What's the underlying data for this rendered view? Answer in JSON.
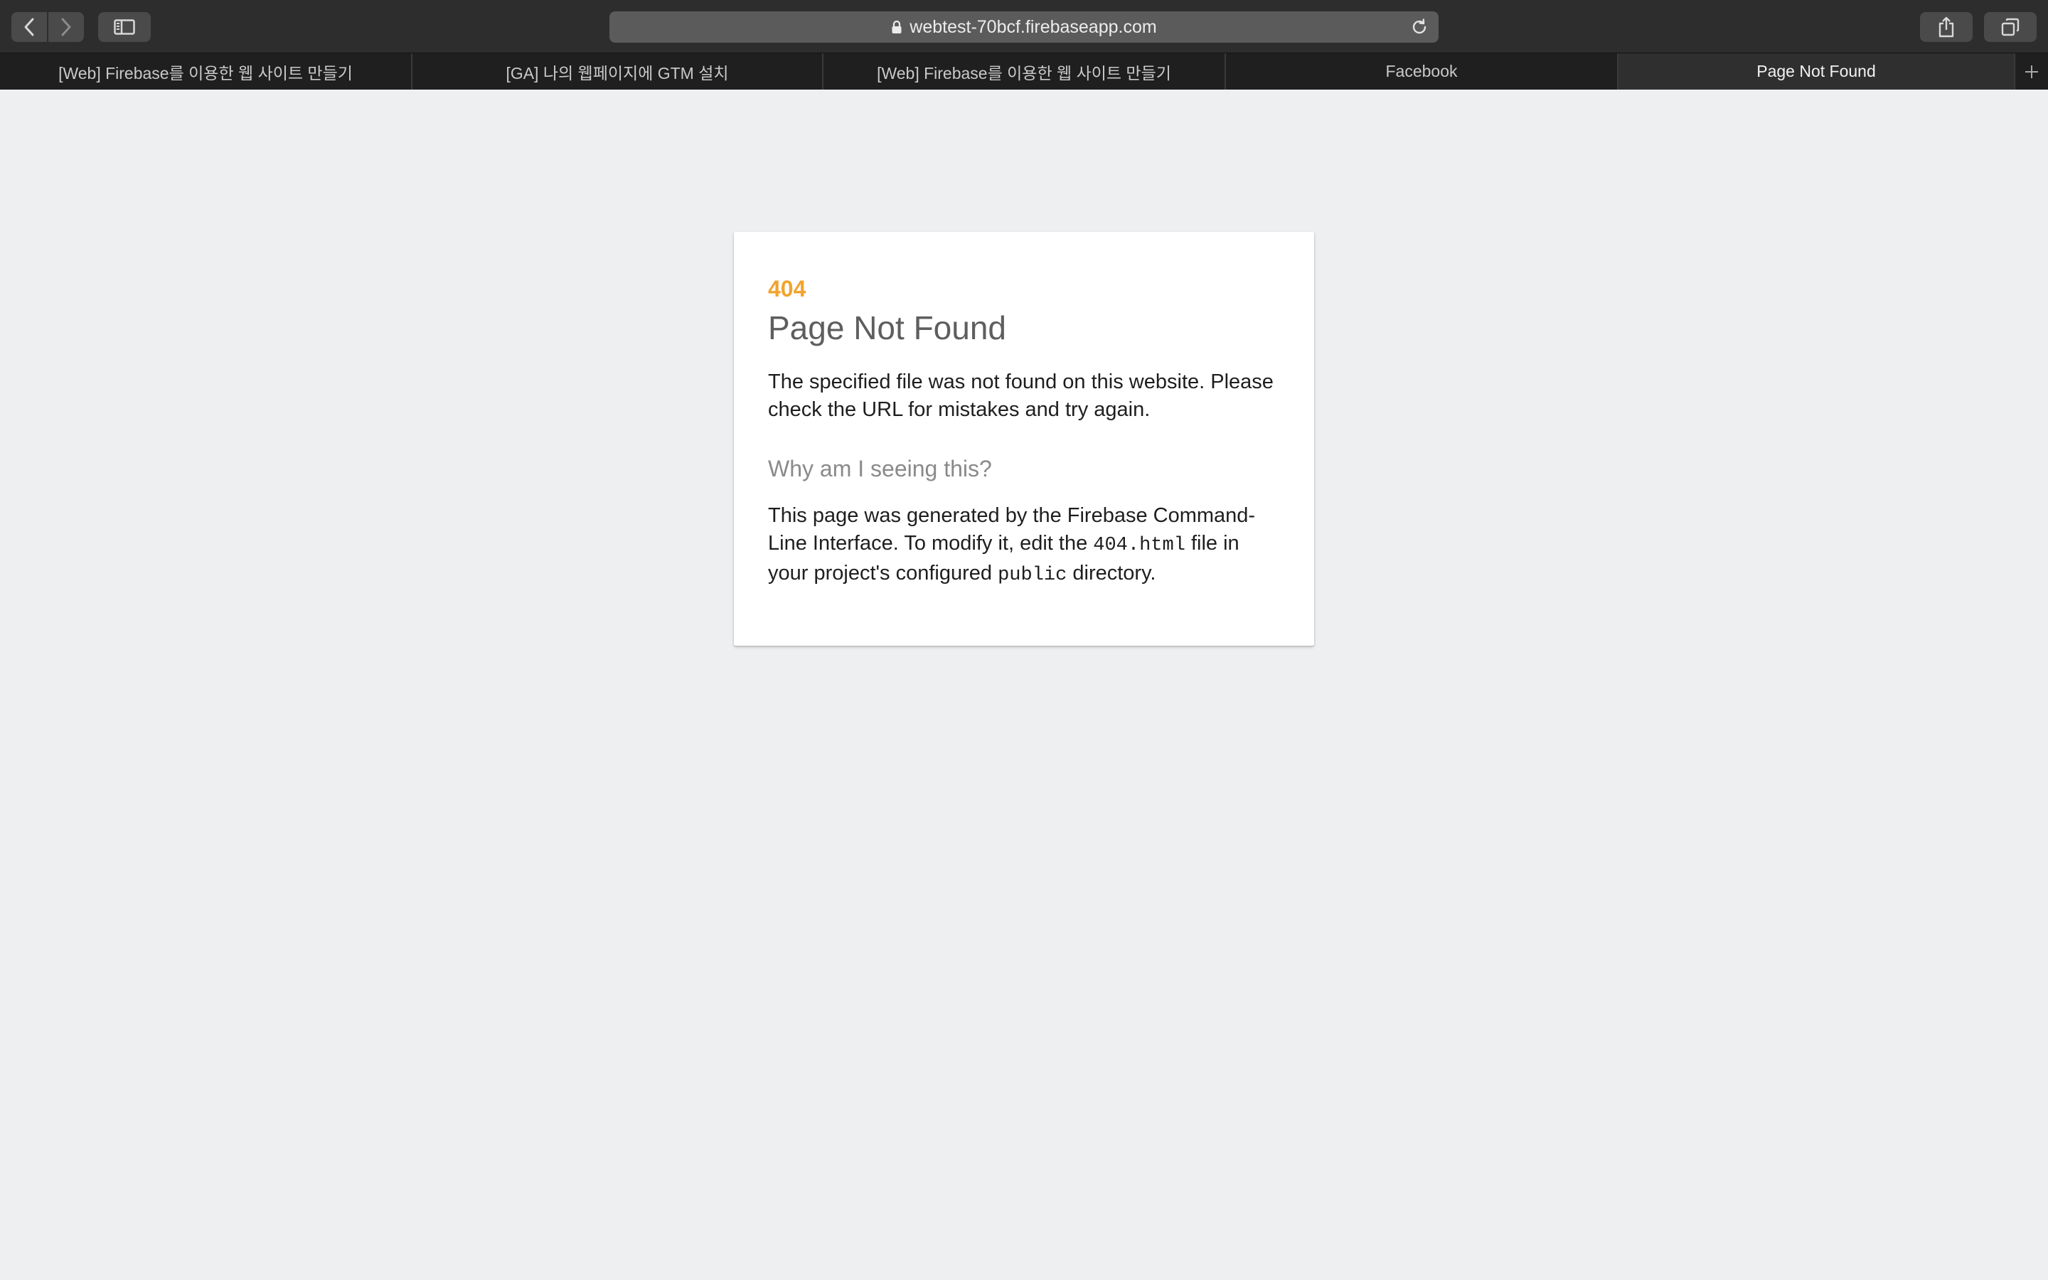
{
  "toolbar": {
    "url": "webtest-70bcf.firebaseapp.com"
  },
  "tabs": [
    {
      "label": "[Web] Firebase를 이용한 웹 사이트 만들기",
      "active": false
    },
    {
      "label": "[GA] 나의 웹페이지에 GTM 설치",
      "active": false
    },
    {
      "label": "[Web] Firebase를 이용한 웹 사이트 만들기",
      "active": false
    },
    {
      "label": "Facebook",
      "active": false
    },
    {
      "label": "Page Not Found",
      "active": true
    }
  ],
  "icons": {
    "back": "chevron-left-icon",
    "forward": "chevron-right-icon",
    "sidebar": "sidebar-icon",
    "lock": "lock-icon",
    "reload": "reload-icon",
    "share": "share-icon",
    "tabs": "tabs-overview-icon",
    "new_tab": "plus-icon"
  },
  "colors": {
    "accent_code": "#f2a32e",
    "page_bg": "#eeeff1"
  },
  "content": {
    "code": "404",
    "title": "Page Not Found",
    "message": "The specified file was not found on this website. Please check the URL for mistakes and try again.",
    "why_heading": "Why am I seeing this?",
    "desc_part1": "This page was generated by the Firebase Command-Line Interface. To modify it, edit the ",
    "desc_file": "404.html",
    "desc_part2": " file in your project's configured ",
    "desc_dir": "public",
    "desc_part3": " directory."
  }
}
